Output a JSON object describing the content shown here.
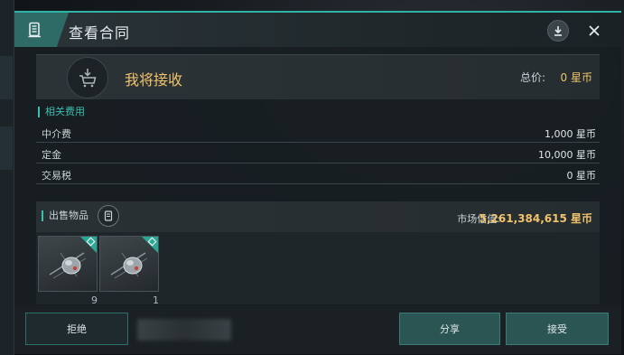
{
  "dialog": {
    "title": "查看合同"
  },
  "header": {
    "title": "我将接收",
    "total_label": "总价:",
    "total_value": "0 星币"
  },
  "fees": {
    "section_title": "相关费用",
    "rows": [
      {
        "label": "中介费",
        "value": "1,000 星币"
      },
      {
        "label": "定金",
        "value": "10,000 星币"
      },
      {
        "label": "交易税",
        "value": "0 星币"
      }
    ]
  },
  "items": {
    "section_title": "出售物品",
    "market_label": "市场估值:",
    "market_value": "5,261,384,615 星币",
    "list": [
      {
        "qty": "9"
      },
      {
        "qty": "1"
      }
    ]
  },
  "footer": {
    "reject_label": "拒绝",
    "share_label": "分享",
    "accept_label": "接受"
  },
  "colors": {
    "accent": "#3cbfb0",
    "gold": "#f0c36b",
    "button": "#2a5553"
  },
  "icons": {
    "title": "contract-icon",
    "download": "download-icon",
    "close": "close-icon",
    "receive": "cart-receive-icon",
    "info": "document-icon",
    "badge": "diamond-icon"
  }
}
